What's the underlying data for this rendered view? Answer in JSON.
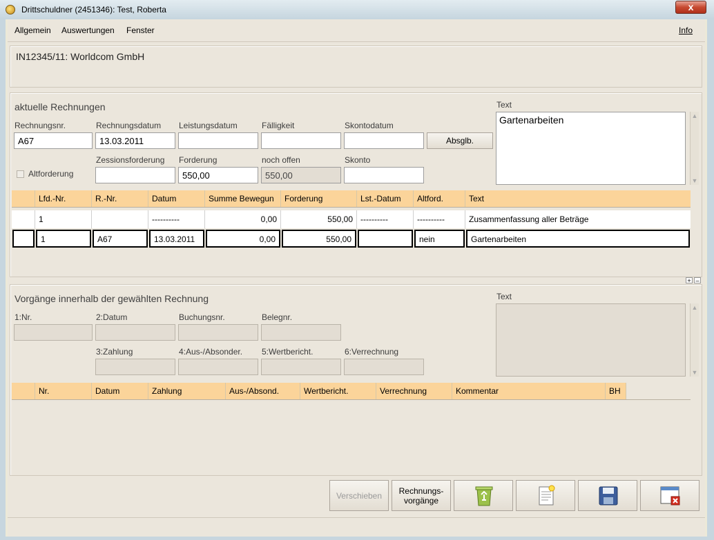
{
  "window": {
    "title": "Drittschuldner (2451346): Test, Roberta",
    "close_label": "x"
  },
  "menu": {
    "items": [
      "Allgemein",
      "Auswertungen",
      "Fenster"
    ],
    "info": "Info"
  },
  "header": {
    "case": "IN12345/11: Worldcom GmbH"
  },
  "rechnungen": {
    "title": "aktuelle Rechnungen",
    "labels": {
      "rechnungsnr": "Rechnungsnr.",
      "rechnungsdatum": "Rechnungsdatum",
      "leistungsdatum": "Leistungsdatum",
      "faelligkeit": "Fälligkeit",
      "skontodatum": "Skontodatum",
      "altforderung": "Altforderung",
      "zessionsforderung": "Zessionsforderung",
      "forderung": "Forderung",
      "noch_offen": "noch offen",
      "skonto": "Skonto",
      "text": "Text"
    },
    "values": {
      "rechnungsnr": "A67",
      "rechnungsdatum": "13.03.2011",
      "leistungsdatum": "",
      "faelligkeit": "",
      "skontodatum": "",
      "zessionsforderung": "",
      "forderung": "550,00",
      "noch_offen": "550,00",
      "skonto": "",
      "text": "Gartenarbeiten"
    },
    "absglb_label": "Absglb.",
    "altforderung_checked": false,
    "table": {
      "columns": [
        "",
        "Lfd.-Nr.",
        "R.-Nr.",
        "Datum",
        "Summe Bewegun",
        "Forderung",
        "Lst.-Datum",
        "Altford.",
        "Text"
      ],
      "rows": [
        [
          "",
          "1",
          "",
          "----------",
          "0,00",
          "550,00",
          "----------",
          "----------",
          "Zusammenfassung aller Beträge"
        ],
        [
          "",
          "1",
          "A67",
          "13.03.2011",
          "0,00",
          "550,00",
          "",
          "nein",
          "Gartenarbeiten"
        ]
      ]
    }
  },
  "vorgaenge": {
    "title": "Vorgänge innerhalb der gewählten Rechnung",
    "labels": {
      "nr": "1:Nr.",
      "datum": "2:Datum",
      "buchungsnr": "Buchungsnr.",
      "belegnr": "Belegnr.",
      "zahlung": "3:Zahlung",
      "aus_absonder": "4:Aus-/Absonder.",
      "wertbericht": "5:Wertbericht.",
      "verrechnung": "6:Verrechnung",
      "text": "Text"
    },
    "table": {
      "columns": [
        "",
        "Nr.",
        "Datum",
        "Zahlung",
        "Aus-/Absond.",
        "Wertbericht.",
        "Verrechnung",
        "Kommentar",
        "BH"
      ]
    }
  },
  "splitter": {
    "plus": "+",
    "minus": "–"
  },
  "buttons": {
    "verschieben": "Verschieben",
    "rechnungsvorgaenge_line1": "Rechnungs-",
    "rechnungsvorgaenge_line2": "vorgänge"
  },
  "icons": {
    "recycle": "recycle-bin-icon",
    "document": "new-document-icon",
    "save": "floppy-disk-icon",
    "close": "close-window-icon"
  }
}
